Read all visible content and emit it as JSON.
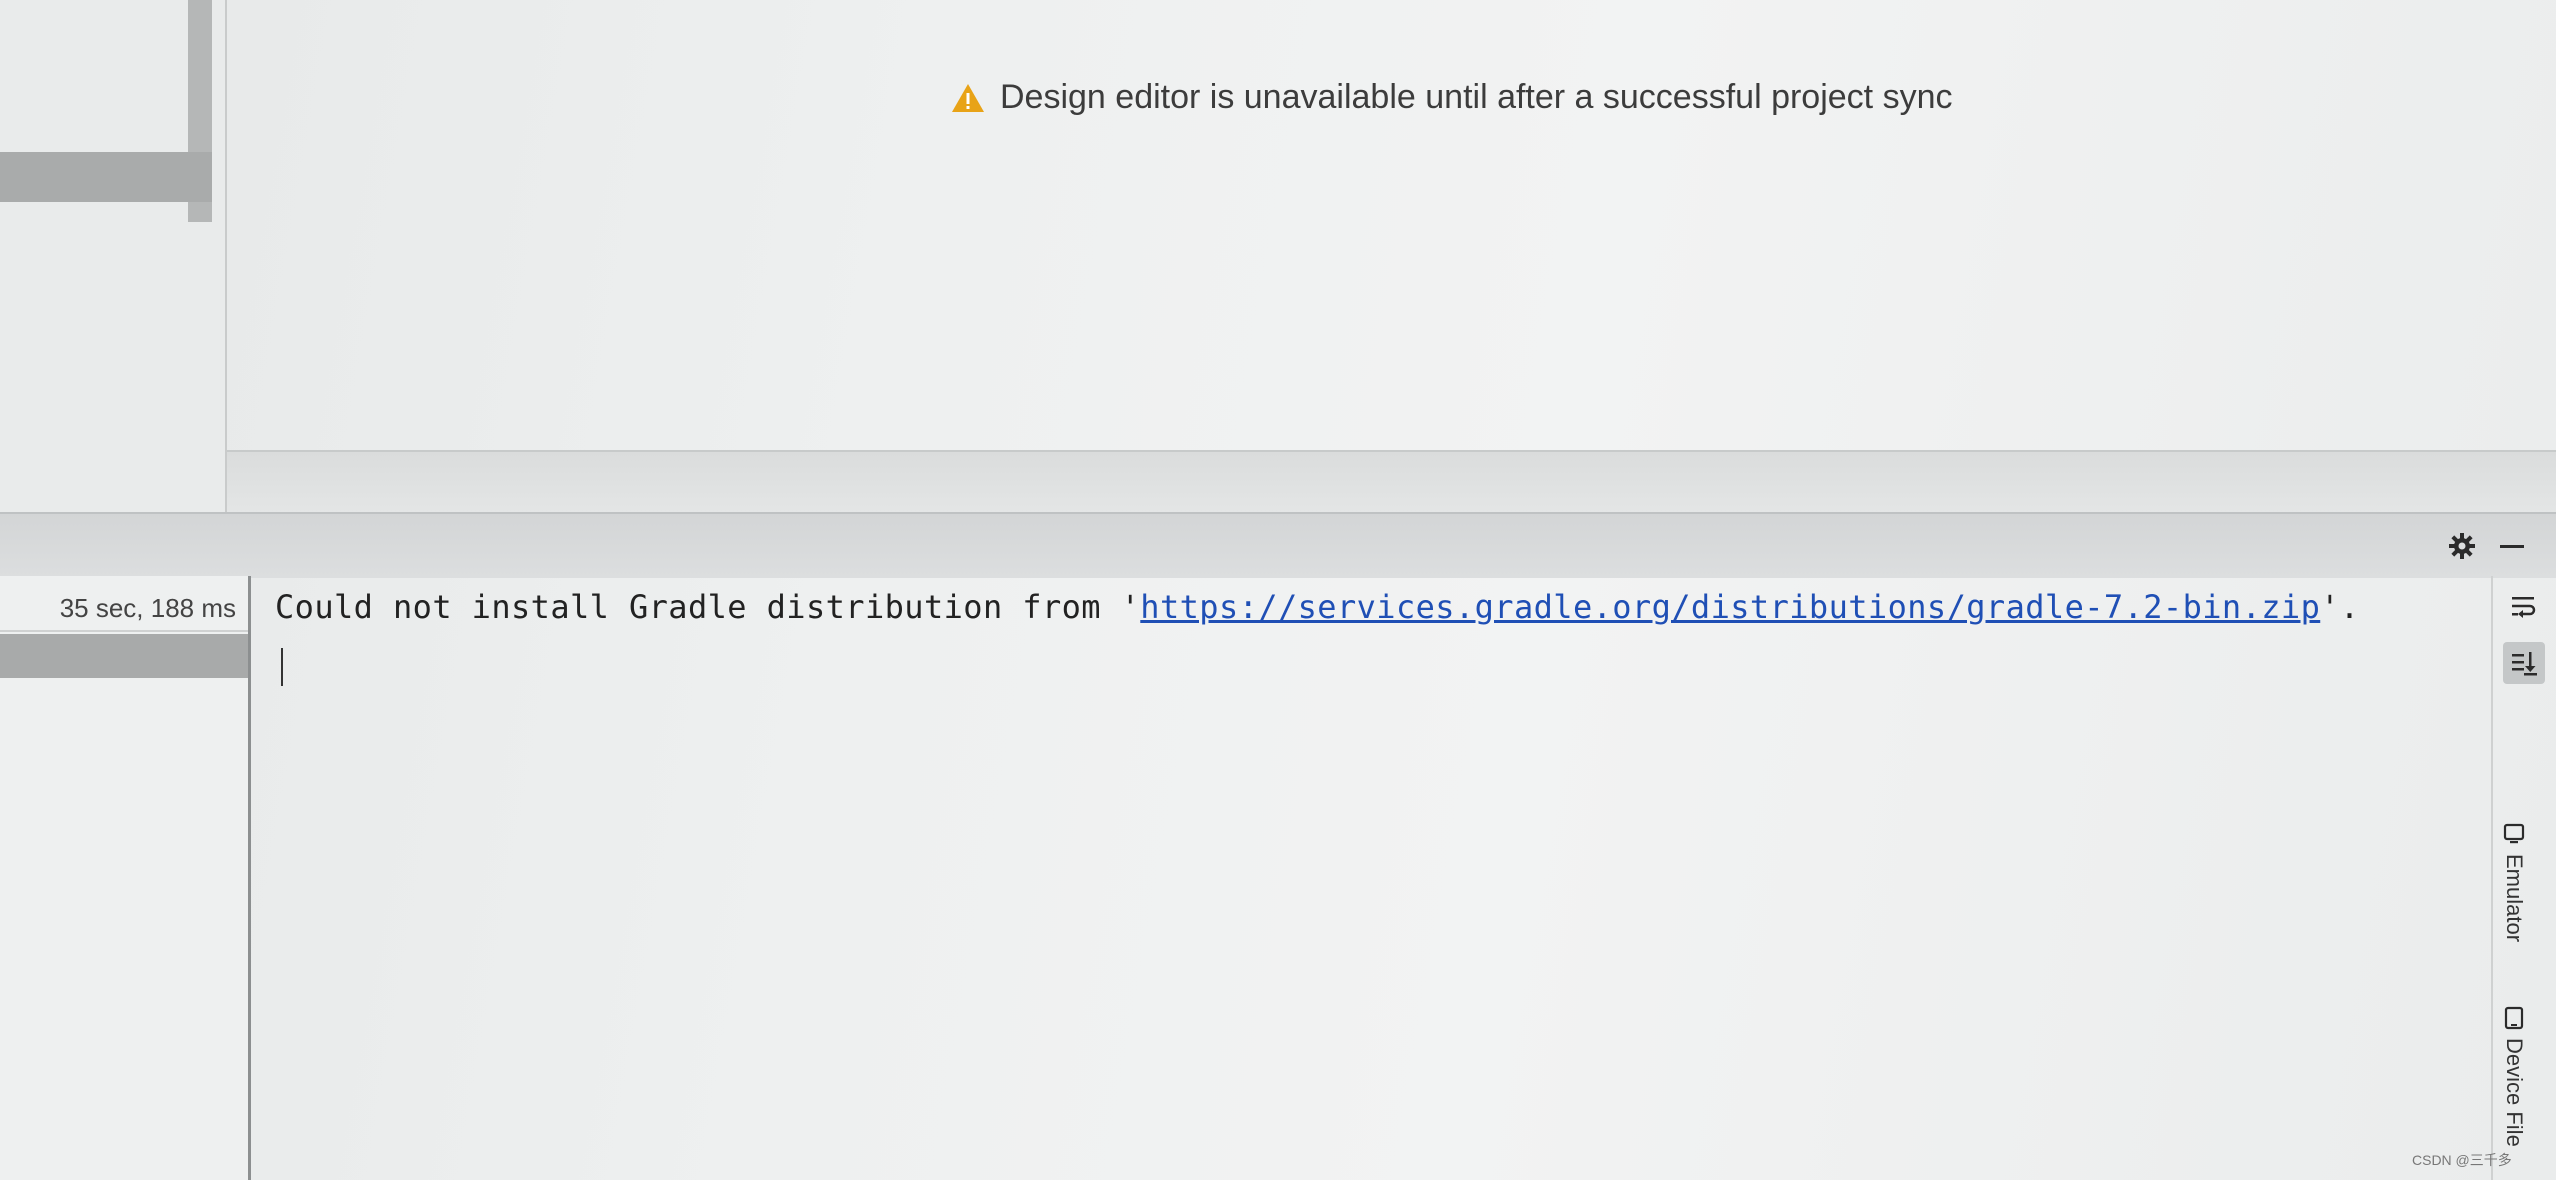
{
  "design": {
    "warning_icon": "warning-triangle-icon",
    "warning_text": "Design editor is unavailable until after a successful project sync",
    "warning_color": "#e8a317"
  },
  "tool_window": {
    "settings_icon": "gear-icon",
    "hide_icon": "minimize-icon"
  },
  "build": {
    "duration": "35 sec, 188 ms",
    "message_prefix": "Could not install Gradle distribution from '",
    "message_link": "https://services.gradle.org/distributions/gradle-7.2-bin.zip",
    "message_suffix": "'.",
    "link_color": "#1f4fb5"
  },
  "right_toolbar": {
    "soft_wrap_icon": "soft-wrap-icon",
    "scroll_to_end_icon": "scroll-to-end-icon"
  },
  "side_tabs": [
    {
      "label": "Emulator",
      "icon": "emulator-icon"
    },
    {
      "label": "Device File",
      "icon": "device-file-icon"
    }
  ],
  "watermark": "CSDN @三千多"
}
